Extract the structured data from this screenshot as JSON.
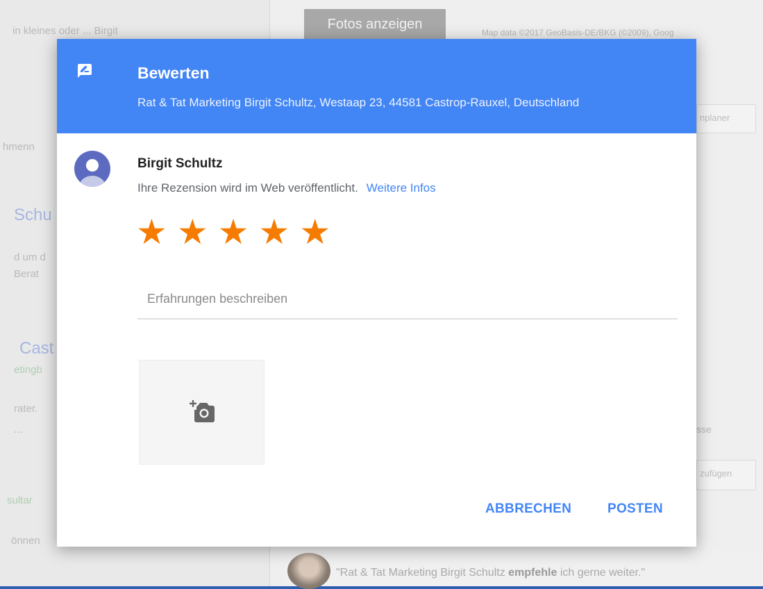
{
  "background": {
    "left_snippets": [
      "in kleines oder ... Birgit",
      "hmenn",
      "Schu",
      "d um d",
      "Berat",
      "Cast",
      "etingb",
      "rater.",
      "...",
      "sultar",
      "önnen"
    ],
    "photos_button": "Fotos anzeigen",
    "map_data": "Map data ©2017 GeoBasis-DE/BKG (©2009), Goog",
    "route_button": "nplaner",
    "address_snippet": "sse",
    "add_button": "zufügen",
    "quote_before": "\"Rat & Tat Marketing Birgit Schultz ",
    "quote_bold": "empfehle",
    "quote_after": " ich gerne weiter.\""
  },
  "dialog": {
    "title": "Bewerten",
    "subtitle": "Rat & Tat Marketing Birgit Schultz, Westaap 23, 44581 Castrop-Rauxel, Deutschland",
    "user_name": "Birgit Schultz",
    "notice": "Ihre Rezension wird im Web veröffentlicht.",
    "more_info_link": "Weitere Infos",
    "rating": 5,
    "max_rating": 5,
    "review_placeholder": "Erfahrungen beschreiben",
    "cancel_label": "ABBRECHEN",
    "post_label": "POSTEN"
  },
  "colors": {
    "header_bg": "#4285f4",
    "star": "#f57c00",
    "link": "#4285f4",
    "avatar": "#5c6bc0"
  },
  "icons": {
    "header": "rate-review-icon",
    "photo": "add-photo-camera-icon",
    "avatar": "person-icon"
  }
}
